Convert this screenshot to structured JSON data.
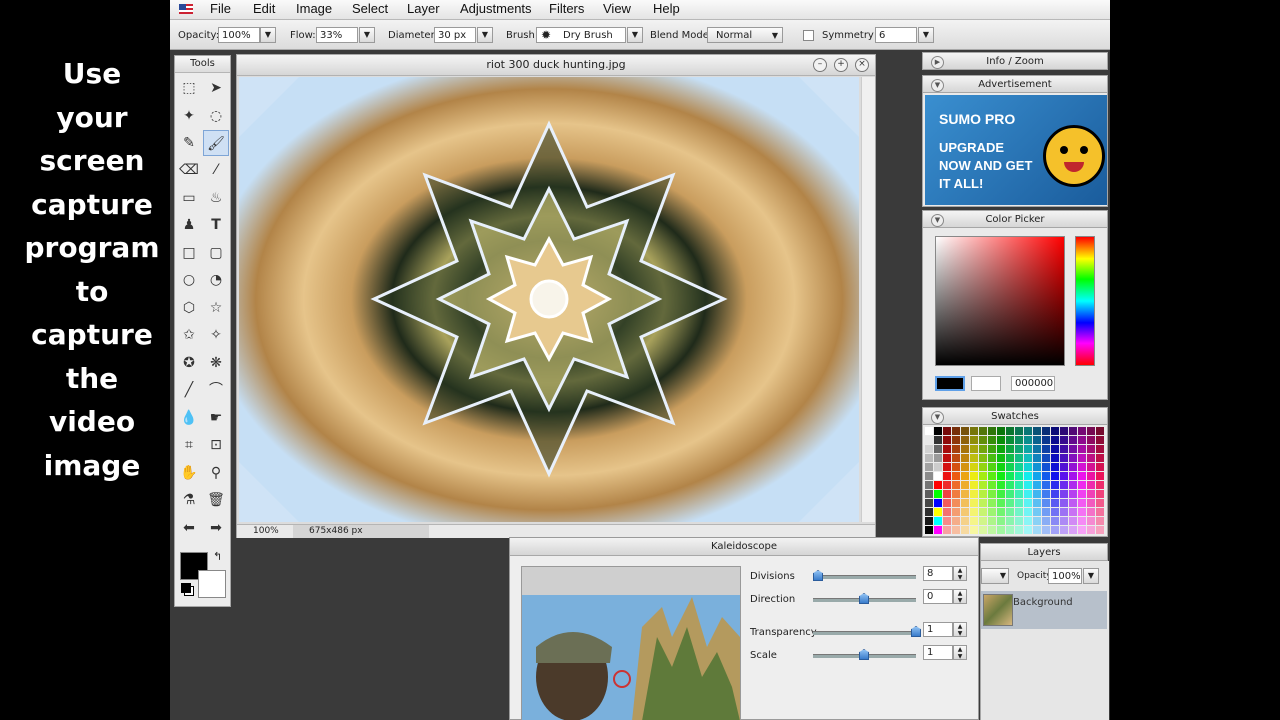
{
  "caption": "Use\nyour\nscreen\ncapture\nprogram\nto\ncapture\nthe\nvideo\nimage",
  "menu": [
    "File",
    "Edit",
    "Image",
    "Select",
    "Layer",
    "Adjustments",
    "Filters",
    "View",
    "Help"
  ],
  "options": {
    "opacity_label": "Opacity:",
    "opacity_value": "100%",
    "flow_label": "Flow:",
    "flow_value": "33%",
    "diameter_label": "Diameter:",
    "diameter_value": "30 px",
    "brush_label": "Brush:",
    "brush_value": "Dry Brush",
    "blend_label": "Blend Mode:",
    "blend_value": "Normal",
    "symmetry_label": "Symmetry",
    "symmetry_value": "6"
  },
  "tools_title": "Tools",
  "document": {
    "title": "riot 300 duck hunting.jpg",
    "zoom": "100%",
    "size": "675x486 px"
  },
  "panels": {
    "info_zoom": "Info / Zoom",
    "advertisement": "Advertisement",
    "ad_title": "SUMO PRO",
    "ad_text": "UPGRADE NOW AND GET IT ALL!",
    "color_picker": "Color Picker",
    "hex_value": "000000",
    "swatches": "Swatches",
    "layers": "Layers",
    "layer_opacity_label": "Opacity:",
    "layer_opacity_value": "100%",
    "layer_name": "Background"
  },
  "kaleidoscope": {
    "title": "Kaleidoscope",
    "divisions_label": "Divisions",
    "divisions_value": "8",
    "direction_label": "Direction",
    "direction_value": "0",
    "transparency_label": "Transparency",
    "transparency_value": "1",
    "scale_label": "Scale",
    "scale_value": "1"
  },
  "colors": {
    "accent": "#5fa0e8",
    "foreground": "#000000",
    "background": "#ffffff"
  }
}
